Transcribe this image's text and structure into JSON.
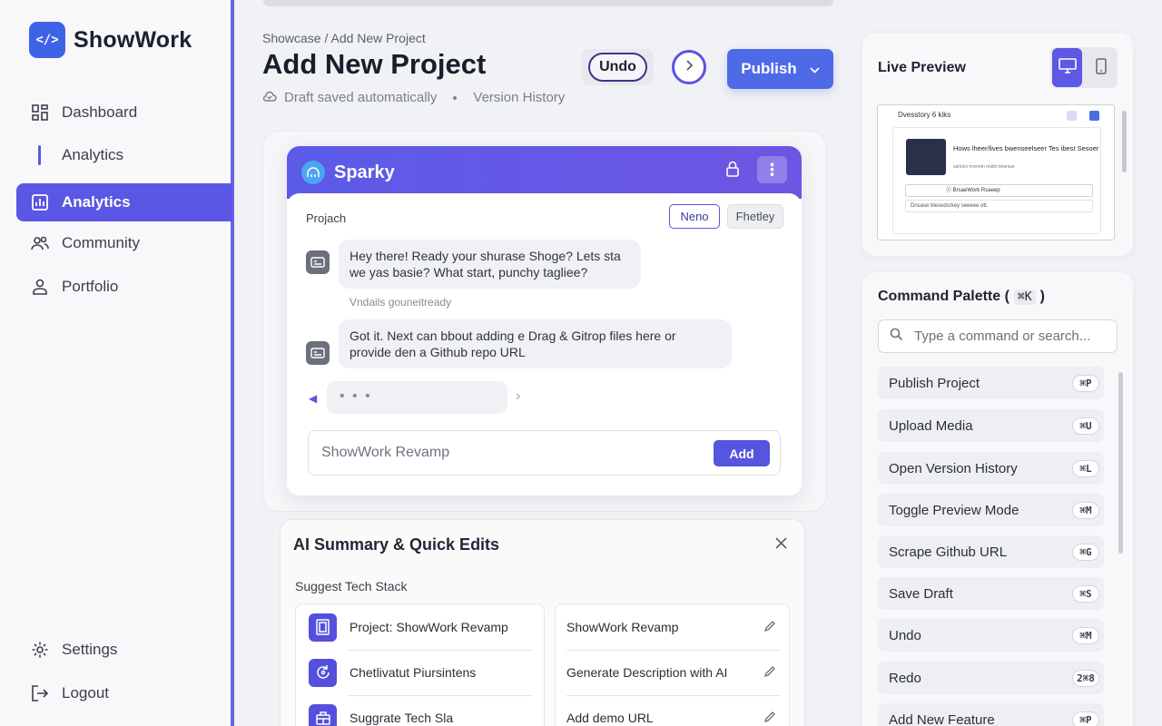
{
  "brand": {
    "name": "ShowWork",
    "logo_text": "</>"
  },
  "sidebar": {
    "items": [
      {
        "label": "Dashboard",
        "icon": "dashboard-grid-icon"
      },
      {
        "label": "Analytics",
        "icon": "sub-indicator"
      },
      {
        "label": "Analytics",
        "icon": "bar-chart-icon",
        "active": true
      },
      {
        "label": "Community",
        "icon": "people-icon"
      },
      {
        "label": "Portfolio",
        "icon": "user-icon"
      }
    ],
    "bottom": [
      {
        "label": "Settings",
        "icon": "gear-icon"
      },
      {
        "label": "Logout",
        "icon": "logout-icon"
      }
    ]
  },
  "header": {
    "breadcrumb": "Showcase / Add New Project",
    "title": "Add New Project",
    "draft_status": "Draft saved automatically",
    "version_link": "Version History",
    "undo_label": "Undo",
    "publish_label": "Publish"
  },
  "chat": {
    "assistant_name": "Sparky",
    "project_label": "Projach",
    "chips": [
      "Neno",
      "Fhetley"
    ],
    "messages": [
      {
        "text": "Hey there! Ready your shurase Shoge? Lets sta we yas basie? What start, punchy tagliee?"
      },
      {
        "text": "Got it. Next can bbout adding e Drag & Gitrop files here or provide den a Github repo URL"
      }
    ],
    "system_note": "Vndails gouneitready",
    "typing_indicator": "• • •",
    "input_value": "ShowWork Revamp",
    "add_label": "Add"
  },
  "summary": {
    "title": "AI Summary & Quick Edits",
    "subtitle": "Suggest Tech Stack",
    "left_items": [
      {
        "label": "Project: ShowWork Revamp",
        "icon": "document-icon"
      },
      {
        "label": "Chetlivatut Piursintens",
        "icon": "refresh-icon"
      },
      {
        "label": "Suggrate Tech Sla",
        "icon": "stack-icon"
      }
    ],
    "right_items": [
      {
        "label": "ShowWork Revamp"
      },
      {
        "label": "Generate Description with AI"
      },
      {
        "label": "Add demo URL"
      }
    ]
  },
  "preview": {
    "title": "Live Preview",
    "frame_header": "Dvesstory 6 kiks",
    "frame_title": "Hows lheer/lives bwenseelseer Tes ibest Sesoer",
    "frame_small": "sarlolrs rrrnnnin nndm bnsniue",
    "frame_select": "ⓒ  BrsaeWork Rsaeep",
    "frame_input": "Dnsase blesedsrkey seeeee ott."
  },
  "palette": {
    "title": "Command Palette (",
    "title_kbd": "⌘K",
    "title_close": ")",
    "search_placeholder": "Type a command or search...",
    "commands": [
      {
        "label": "Publish Project",
        "shortcut": "⌘P"
      },
      {
        "label": "Upload Media",
        "shortcut": "⌘U"
      },
      {
        "label": "Open Version History",
        "shortcut": "⌘L"
      },
      {
        "label": "Toggle Preview Mode",
        "shortcut": "⌘M"
      },
      {
        "label": "Scrape Github URL",
        "shortcut": "⌘G"
      },
      {
        "label": "Save Draft",
        "shortcut": "⌘S"
      },
      {
        "label": "Undo",
        "shortcut": "⌘M"
      },
      {
        "label": "Redo",
        "shortcut": "2⌘8"
      },
      {
        "label": "Add New Feature",
        "shortcut": "⌘P"
      }
    ]
  },
  "colors": {
    "accent": "#5b56e3",
    "publish": "#4f6ae6",
    "background": "#f1f2f5"
  }
}
